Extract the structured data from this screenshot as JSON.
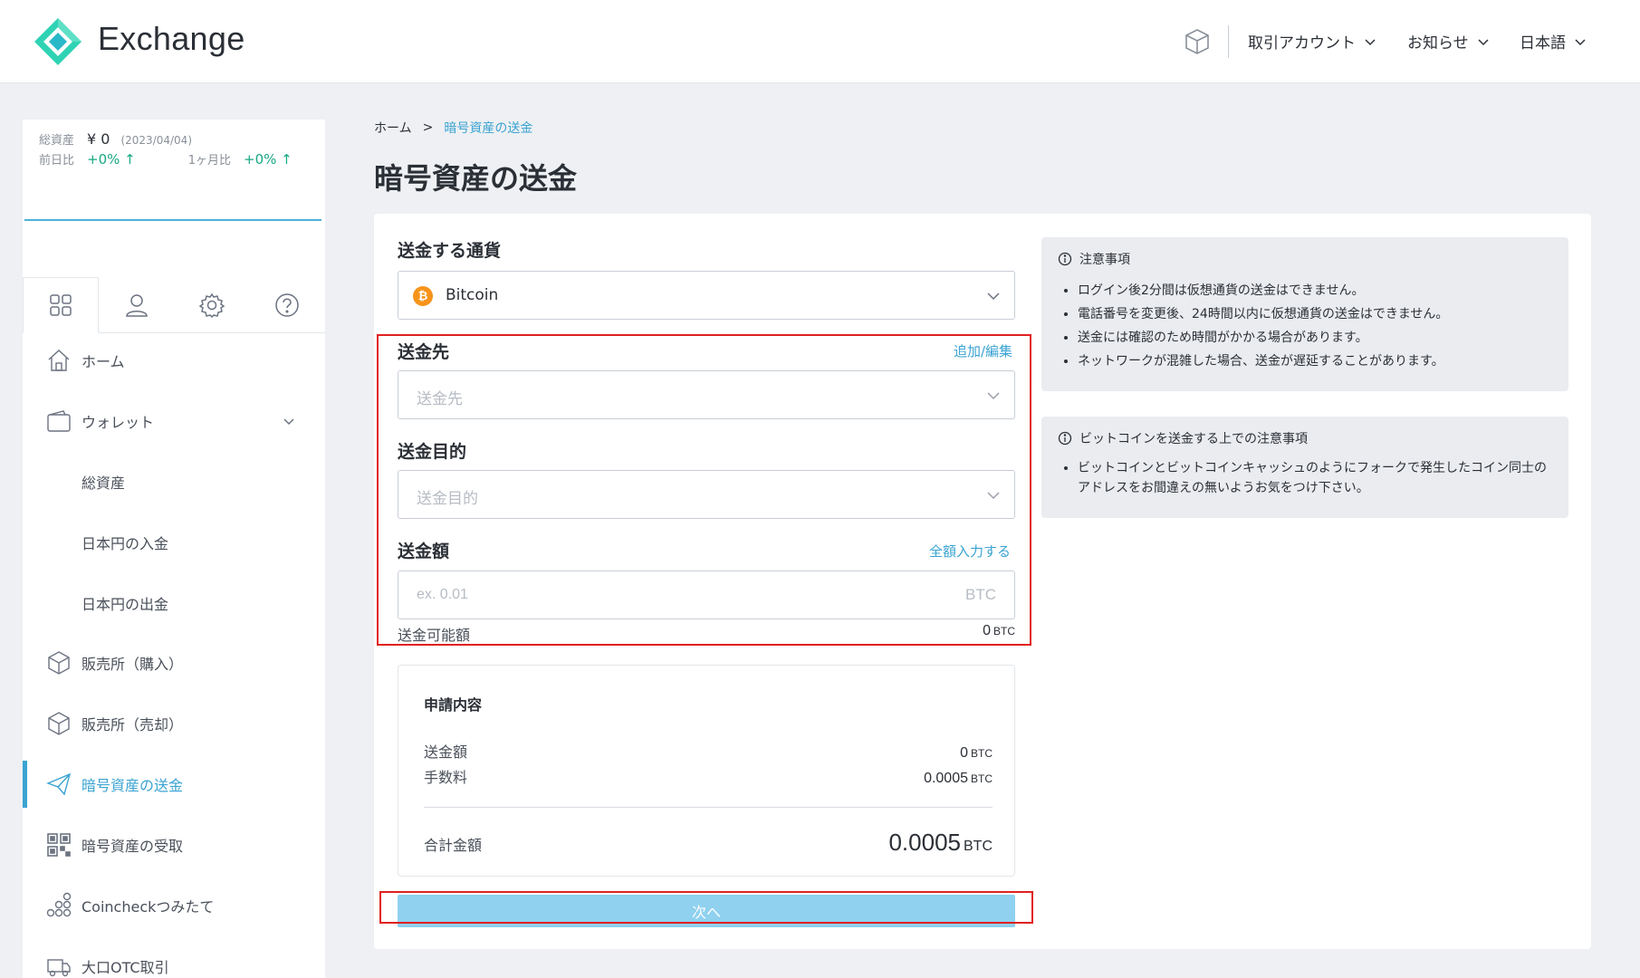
{
  "header": {
    "brand": "Exchange",
    "menu": [
      {
        "label": "取引アカウント"
      },
      {
        "label": "お知らせ"
      },
      {
        "label": "日本語"
      }
    ]
  },
  "sidebar": {
    "assets": {
      "total_label": "総資産",
      "total_value": "¥ 0",
      "date": "(2023/04/04)",
      "day_label": "前日比",
      "day_value": "+0% ↑",
      "month_label": "1ヶ月比",
      "month_value": "+0% ↑"
    },
    "nav": [
      {
        "label": "ホーム"
      },
      {
        "label": "ウォレット"
      },
      {
        "label": "総資産"
      },
      {
        "label": "日本円の入金"
      },
      {
        "label": "日本円の出金"
      },
      {
        "label": "販売所（購入）"
      },
      {
        "label": "販売所（売却）"
      },
      {
        "label": "暗号資産の送金"
      },
      {
        "label": "暗号資産の受取"
      },
      {
        "label": "Coincheckつみたて"
      },
      {
        "label": "大口OTC取引"
      }
    ]
  },
  "breadcrumb": {
    "home": "ホーム",
    "sep": ">",
    "current": "暗号資産の送金"
  },
  "page_title": "暗号資産の送金",
  "form": {
    "currency_label": "送金する通貨",
    "currency_value": "Bitcoin",
    "destination_label": "送金先",
    "destination_link": "追加/編集",
    "destination_placeholder": "送金先",
    "purpose_label": "送金目的",
    "purpose_placeholder": "送金目的",
    "amount_label": "送金額",
    "amount_link": "全額入力する",
    "amount_placeholder": "ex. 0.01",
    "amount_unit": "BTC",
    "available_label": "送金可能額",
    "available_value": "0",
    "available_unit": "BTC"
  },
  "summary": {
    "title": "申請内容",
    "amount_label": "送金額",
    "amount_value": "0",
    "fee_label": "手数料",
    "fee_value": "0.0005",
    "total_label": "合計金額",
    "total_value": "0.0005",
    "unit": "BTC"
  },
  "next_button": "次へ",
  "notes": [
    {
      "title": "注意事項",
      "items": [
        "ログイン後2分間は仮想通貨の送金はできません。",
        "電話番号を変更後、24時間以内に仮想通貨の送金はできません。",
        "送金には確認のため時間がかかる場合があります。",
        "ネットワークが混雑した場合、送金が遅延することがあります。"
      ]
    },
    {
      "title": "ビットコインを送金する上での注意事項",
      "items": [
        "ビットコインとビットコインキャッシュのようにフォークで発生したコイン同士のアドレスをお間違えの無いようお気をつけ下さい。"
      ]
    }
  ],
  "colors": {
    "accent": "#3aa3d2",
    "positive": "#17a884",
    "bitcoin": "#f7931a",
    "highlight": "#e02020",
    "button": "#8fd1ef"
  }
}
